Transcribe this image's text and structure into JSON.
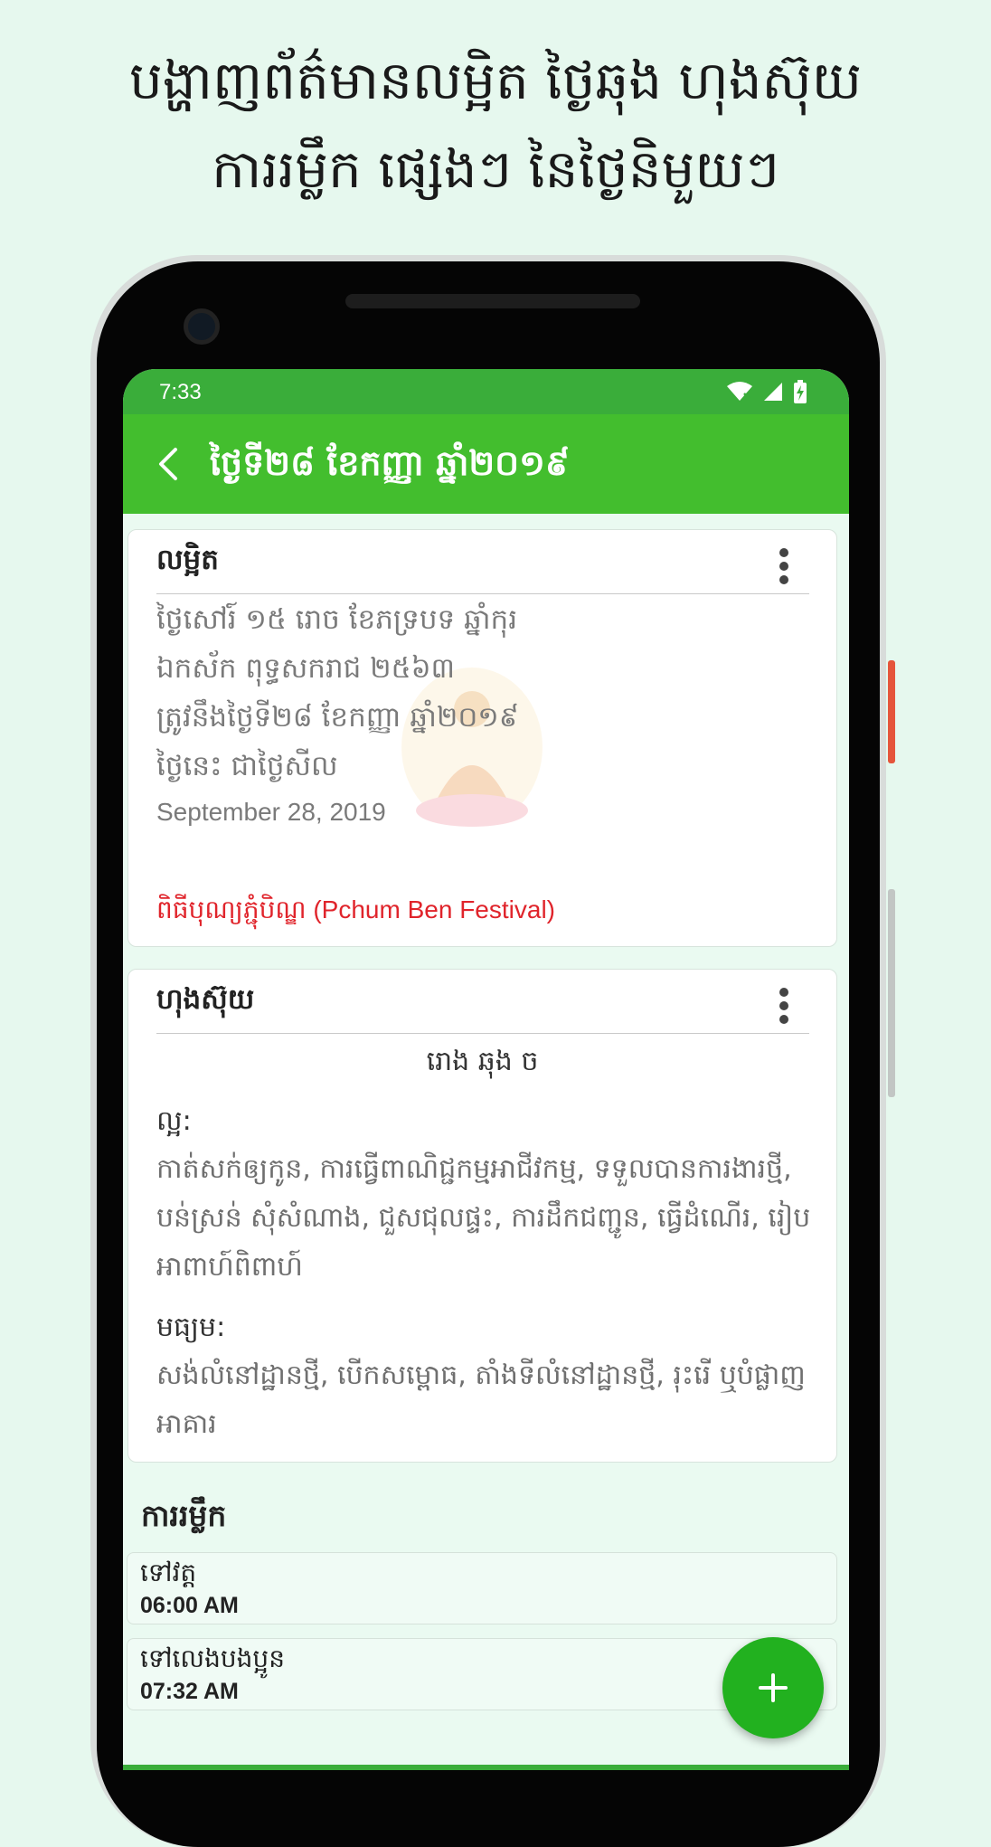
{
  "promo": {
    "line1": "បង្ហាញព័ត៌មានលម្អិត ថ្ងៃឆុង ហុងស៊ុយ",
    "line2": "ការរម្លឹក ផ្សេងៗ នៃថ្ងៃនិមួយៗ"
  },
  "status_bar": {
    "time": "7:33"
  },
  "app_bar": {
    "title": "ថ្ងៃទី២៨ ខែកញ្ញា ឆ្នាំ២០១៩"
  },
  "lunar_card": {
    "title": "លម្អិត",
    "lines": [
      "ថ្ងៃសៅរ៍ ១៥ រោច ខែភទ្របទ ឆ្នាំកុរ",
      "ឯកស័ក ពុទ្ធសករាជ ២៥៦៣",
      "ត្រូវនឹងថ្ងៃទី២៨ ខែកញ្ញា ឆ្នាំ២០១៩",
      "ថ្ងៃនេះ ជាថ្ងៃសីល"
    ],
    "gregorian_date": "September 28, 2019",
    "festival": "ពិធីបុណ្យភ្ជុំបិណ្ឌ (Pchum Ben Festival)"
  },
  "hora_card": {
    "title": "ហុងស៊ុយ",
    "day_signs": "រោង ឆុង ច",
    "good_label": "ល្អ:",
    "good_text": "កាត់សក់ឲ្យកូន, ការធ្វើពាណិជ្ជកម្មអាជីវកម្ម, ទទួលបានការងារថ្មី, បន់ស្រន់ សុំសំណាង, ជួសជុលផ្ទះ, ការដឹកជញ្ជូន, ធ្វើដំណើរ, រៀបអាពាហ៍ពិពាហ៍",
    "medium_label": "មធ្យម:",
    "medium_text": "សង់លំនៅដ្ឋានថ្មី, បើកសម្ពោធ, តាំងទីលំនៅដ្ឋានថ្មី, រុះរើ ឬបំផ្លាញអាគារ"
  },
  "events": {
    "heading": "ការរម្លឹក",
    "items": [
      {
        "title": "ទៅវត្ត",
        "time": "06:00 AM"
      },
      {
        "title": "ទៅលេងបងប្អូន",
        "time": "07:32 AM"
      }
    ]
  },
  "colors": {
    "background": "#e6f8ee",
    "app_bar": "#43be2e",
    "status_bar": "#3aad3a",
    "fab": "#22b11f",
    "festival_text": "#e0242b"
  },
  "icons": {
    "back": "arrow-back-icon",
    "more": "more-vert-icon",
    "wifi": "wifi-icon",
    "signal": "signal-icon",
    "battery": "battery-charging-icon",
    "add": "plus-icon"
  }
}
